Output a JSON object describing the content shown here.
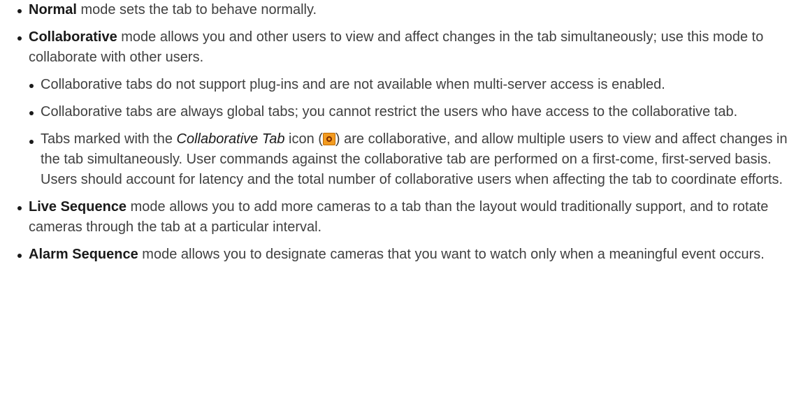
{
  "items": [
    {
      "term": "Normal",
      "text": " mode sets the tab to behave normally."
    },
    {
      "term": "Collaborative",
      "text": " mode allows you and other users to view and affect changes in the tab simultaneously; use this mode to collaborate with other users.",
      "subitems": [
        "Collaborative tabs do not support plug-ins and are not available when multi-server access is enabled.",
        "Collaborative tabs are always global tabs; you cannot restrict the users who have access to the collaborative tab."
      ],
      "icon_item": {
        "pre": "Tabs marked with the ",
        "italic": "Collaborative Tab",
        "mid": " icon (",
        "icon_name": "collaborative-tab-icon",
        "post": ") are collaborative, and allow multiple users to view and affect changes in the tab simultaneously. User commands against the collaborative tab are performed on a first-come, first-served basis. Users should account for latency and the total number of collaborative users when affecting the tab to coordinate efforts."
      }
    },
    {
      "term": "Live Sequence",
      "text": " mode allows you to add more cameras to a tab than the layout would traditionally support, and to rotate cameras through the tab at a particular interval."
    },
    {
      "term": "Alarm Sequence",
      "text": " mode allows you to designate cameras that you want to watch only when a meaningful event occurs."
    }
  ]
}
